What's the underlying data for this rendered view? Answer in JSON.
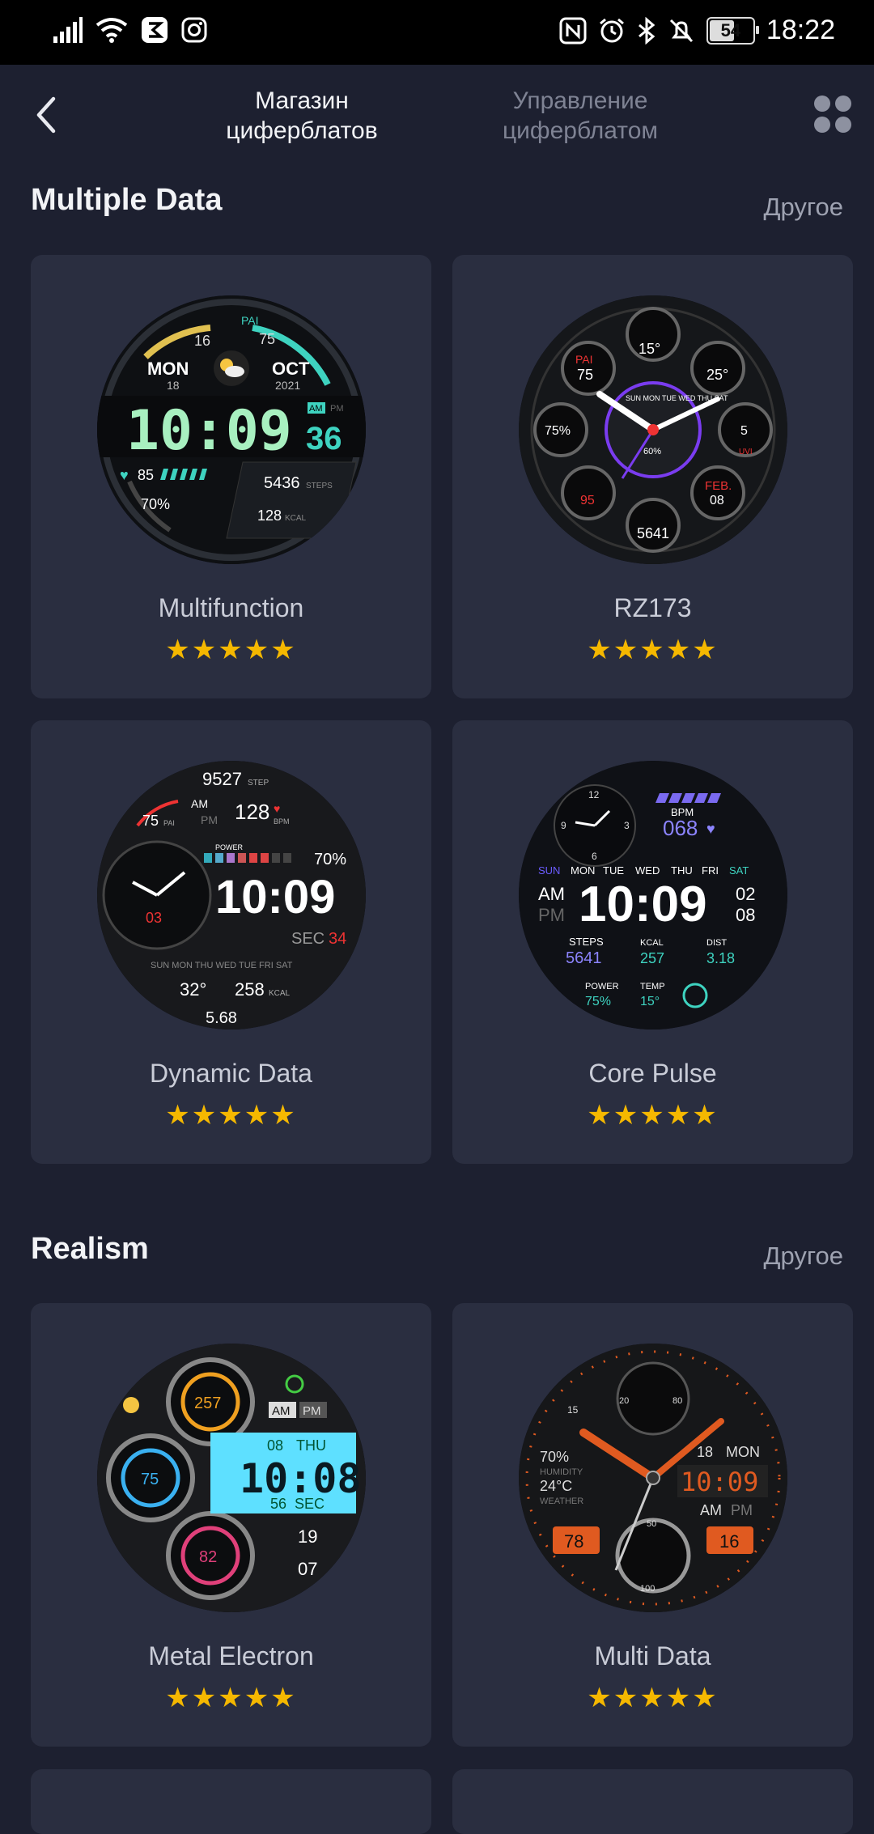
{
  "status_bar": {
    "time": "18:22",
    "battery": "54"
  },
  "header": {
    "tab_store": "Магазин\nциферблатов",
    "tab_manage": "Управление\nциферблатом"
  },
  "sections": [
    {
      "title": "Multiple Data",
      "more": "Другое",
      "items": [
        {
          "name": "Multifunction",
          "rating": "★★★★★"
        },
        {
          "name": "RZ173",
          "rating": "★★★★★"
        },
        {
          "name": "Dynamic Data",
          "rating": "★★★★★"
        },
        {
          "name": "Core Pulse",
          "rating": "★★★★★"
        }
      ]
    },
    {
      "title": "Realism",
      "more": "Другое",
      "items": [
        {
          "name": "Metal Electron",
          "rating": "★★★★★"
        },
        {
          "name": "Multi Data",
          "rating": "★★★★★"
        }
      ]
    }
  ],
  "faces": {
    "multifunction": {
      "day": "MON",
      "date": "18",
      "month": "OCT",
      "year": "2021",
      "time": "10:09",
      "sec": "36",
      "ampm": "AM",
      "pm": "PM",
      "v16": "16",
      "v75": "75",
      "pai": "PAI",
      "hr": "85",
      "pct": "70%",
      "steps": "5436",
      "steps_label": "STEPS",
      "kcal": "128",
      "kcal_label": "KCAL"
    },
    "rz173": {
      "temp": "15°",
      "pai": "PAI",
      "pai_val": "75",
      "fire": "25°",
      "bat": "75%",
      "uvi": "5",
      "uvi_label": "UVI",
      "month": "FEB.",
      "date": "08",
      "steps": "5641",
      "hr": "95",
      "days": "SUN MON TUE WED THU SAT",
      "center_pct": "60%"
    },
    "dynamic": {
      "steps": "9527",
      "step_label": "STEP",
      "am": "AM",
      "pm": "PM",
      "bpm": "128",
      "bpm_label": "BPM",
      "pai": "75",
      "pai_label": "PAI",
      "power": "POWER",
      "power_pct": "70%",
      "time": "10:09",
      "sec_label": "SEC",
      "sec": "34",
      "dial": "03",
      "days": "SUN MON THU WED TUE FRI SAT",
      "temp": "32°",
      "kcal": "258",
      "kcal_label": "KCAL",
      "dist": "5.68"
    },
    "core": {
      "bpm_label": "BPM",
      "bpm": "068",
      "days": [
        "SUN",
        "MON",
        "TUE",
        "WED",
        "THU",
        "FRI",
        "SAT"
      ],
      "am": "AM",
      "pm": "PM",
      "time": "10:09",
      "month": "02",
      "day": "08",
      "steps_label": "STEPS",
      "steps": "5641",
      "kcal_label": "KCAL",
      "kcal": "257",
      "dist_label": "DIST",
      "dist": "3.18",
      "power_label": "POWER",
      "power": "75%",
      "temp_label": "TEMP",
      "temp": "15°",
      "n12": "12",
      "n9": "9",
      "n3": "3",
      "n6": "6"
    },
    "metal": {
      "kcal": "257",
      "pai": "75",
      "hr": "82",
      "am": "AM",
      "pm": "PM",
      "date": "08",
      "day": "THU",
      "time": "10:08",
      "sec": "56",
      "sec_label": "SEC",
      "steps": "19",
      "water": "07"
    },
    "multidata": {
      "humidity": "70%",
      "humidity_label": "HUMIDITY",
      "temp": "24°C",
      "weather_label": "WEATHER",
      "date": "18",
      "day": "MON",
      "time": "10:09",
      "am": "AM",
      "pm": "PM",
      "left_val": "78",
      "right_val": "16",
      "uv": "15",
      "n20": "20",
      "n80": "80",
      "n50": "50",
      "n100": "100"
    }
  }
}
